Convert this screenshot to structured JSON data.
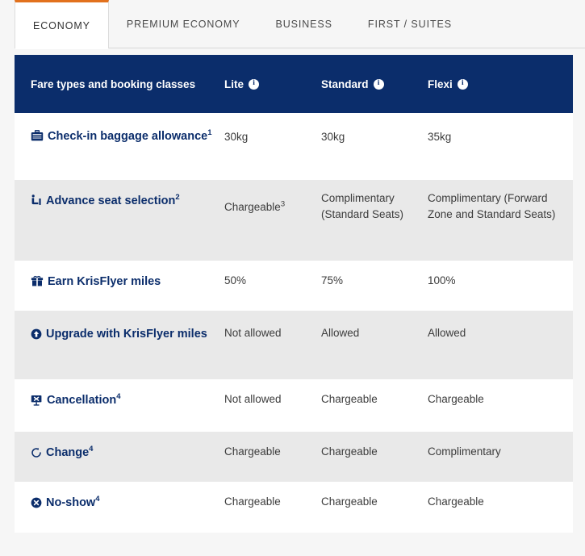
{
  "tabs": [
    {
      "label": "ECONOMY",
      "active": true
    },
    {
      "label": "PREMIUM ECONOMY",
      "active": false
    },
    {
      "label": "BUSINESS",
      "active": false
    },
    {
      "label": "FIRST / SUITES",
      "active": false
    }
  ],
  "colors": {
    "header_navy": "#0b2d6b",
    "active_tab_accent": "#e2711d",
    "alt_row": "#e9e9e9",
    "page_background": "#f6f6f6"
  },
  "table": {
    "headers": [
      {
        "label": "Fare types and booking classes",
        "info": false
      },
      {
        "label": "Lite",
        "info": true,
        "info_glyph": "i"
      },
      {
        "label": "Standard",
        "info": true,
        "info_glyph": "i"
      },
      {
        "label": "Flexi",
        "info": true,
        "info_glyph": "i"
      }
    ],
    "rows": [
      {
        "icon": "suitcase-icon",
        "label": "Check-in baggage allowance",
        "footnote": "1",
        "lite": "30kg",
        "lite_footnote": "",
        "standard": "30kg",
        "flexi": "35kg"
      },
      {
        "icon": "seat-icon",
        "label": "Advance seat selection",
        "footnote": "2",
        "lite": "Chargeable",
        "lite_footnote": "3",
        "standard": "Complimentary (Standard Seats)",
        "flexi": "Complimentary (Forward Zone and Standard Seats)"
      },
      {
        "icon": "gift-icon",
        "label": "Earn KrisFlyer miles",
        "footnote": "",
        "lite": "50%",
        "lite_footnote": "",
        "standard": "75%",
        "flexi": "100%"
      },
      {
        "icon": "upgrade-arrow-icon",
        "label": "Upgrade with KrisFlyer miles",
        "footnote": "",
        "lite": "Not allowed",
        "lite_footnote": "",
        "standard": "Allowed",
        "flexi": "Allowed"
      },
      {
        "icon": "ticket-cancel-icon",
        "label": "Cancellation",
        "footnote": "4",
        "lite": "Not allowed",
        "lite_footnote": "",
        "standard": "Chargeable",
        "flexi": "Chargeable"
      },
      {
        "icon": "refresh-circle-icon",
        "label": "Change",
        "footnote": "4",
        "lite": "Chargeable",
        "lite_footnote": "",
        "standard": "Chargeable",
        "flexi": "Complimentary"
      },
      {
        "icon": "close-circle-icon",
        "label": "No-show",
        "footnote": "4",
        "lite": "Chargeable",
        "lite_footnote": "",
        "standard": "Chargeable",
        "flexi": "Chargeable"
      }
    ]
  }
}
